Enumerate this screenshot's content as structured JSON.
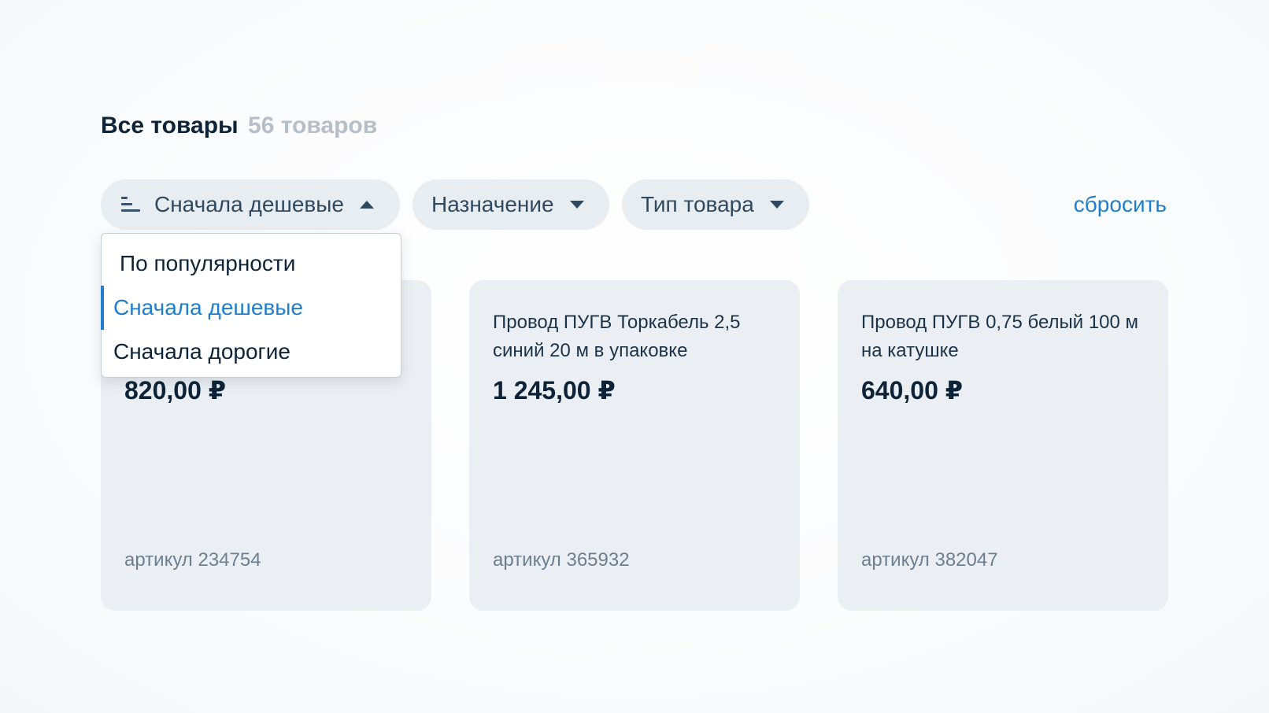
{
  "header": {
    "title": "Все товары",
    "count": "56 товаров"
  },
  "filters": {
    "sort_label": "Сначала дешевые",
    "sort_icon": "sort-icon",
    "purpose_label": "Назначение",
    "type_label": "Тип товара",
    "reset_label": "сбросить"
  },
  "sort_dropdown": {
    "expanded": true,
    "selected": "Сначала дешевые",
    "options": [
      {
        "label": "По популярности"
      },
      {
        "label": "Сначала дешевые"
      },
      {
        "label": "Сначала дорогие"
      }
    ]
  },
  "products": [
    {
      "name": "",
      "price": "820,00 ₽",
      "sku": "артикул 234754"
    },
    {
      "name": "Провод ПУГВ Торкабель 2,5 синий 20 м в упаковке",
      "price": "1 245,00 ₽",
      "sku": "артикул 365932"
    },
    {
      "name": "Провод ПУГВ 0,75 белый 100 м на катушке",
      "price": "640,00 ₽",
      "sku": "артикул 382047"
    }
  ],
  "colors": {
    "accent": "#1f7fce",
    "pill_bg": "#e8edf1",
    "card_bg": "#ebeff3",
    "text_primary": "#0d2438",
    "text_muted": "#b6bfc8"
  }
}
